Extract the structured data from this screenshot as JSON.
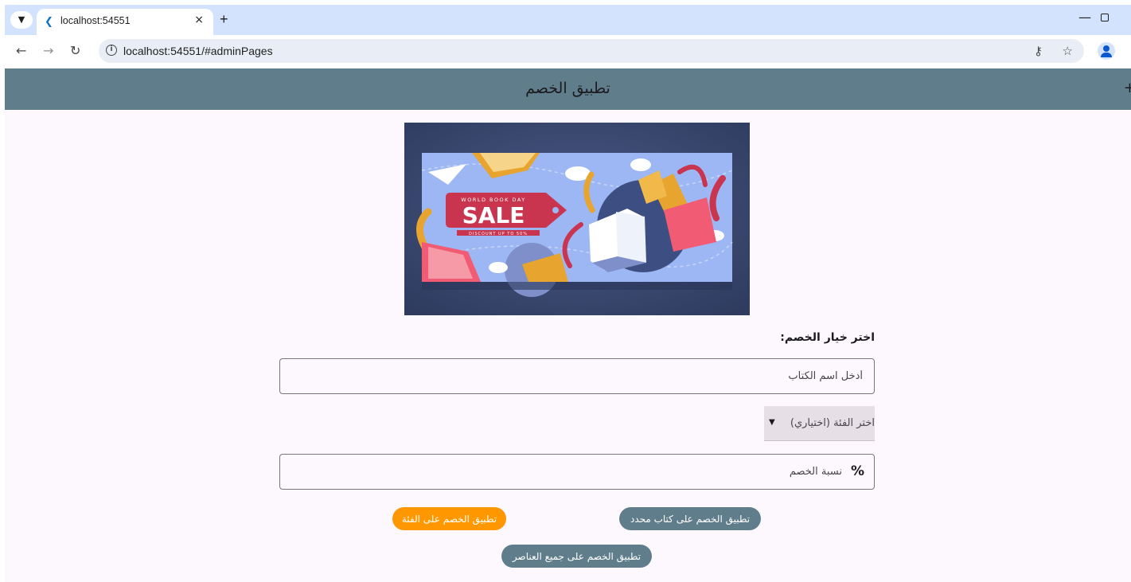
{
  "browser": {
    "tab_title": "localhost:54551",
    "tab_close": "×",
    "new_tab": "+",
    "url": "localhost:54551/#adminPages",
    "minimize": "—",
    "icons": [
      "tab-search-icon",
      "flutter-favicon",
      "back-arrow-icon",
      "forward-arrow-icon",
      "reload-icon",
      "info-icon",
      "key-icon",
      "star-icon",
      "profile-icon"
    ]
  },
  "appbar": {
    "title": "تطبيق الخصم",
    "edge_glyph": "+"
  },
  "banner": {
    "tag_top": "WORLD BOOK DAY",
    "tag_main": "SALE",
    "tag_bottom": "DISCOUNT UP TO 50%",
    "colors": {
      "background": "#39486f",
      "panel": "#9db7f5",
      "tag": "#c9344f",
      "book_yellow": "#e7a42f",
      "book_pink": "#f15b73"
    }
  },
  "form": {
    "label": "اختر خيار الخصم:",
    "book_name_placeholder": "أدخل اسم الكتاب",
    "category_dropdown": "اختر الفئة (اختياري)",
    "discount_placeholder": "نسبة الخصم",
    "percent_symbol": "%"
  },
  "buttons": {
    "apply_book": "تطبيق الخصم على كتاب محدد",
    "apply_category": "تطبيق الخصم على الفئة",
    "apply_all": "تطبيق الخصم على جميع العناصر"
  },
  "colors": {
    "appbar": "#607d8b",
    "page_bg": "#fdf7fe",
    "button_grey": "#607d8b",
    "button_orange": "#ff9800"
  }
}
